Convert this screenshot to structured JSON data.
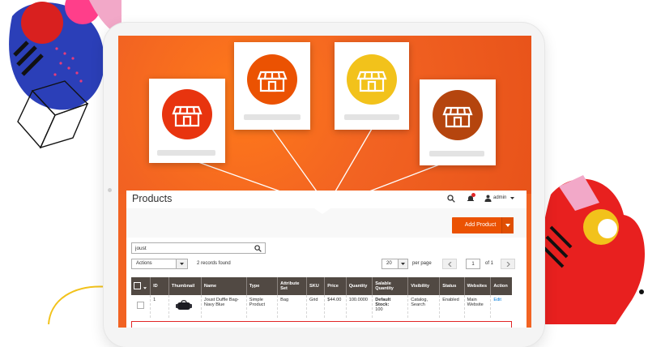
{
  "toolbar": {
    "title": "Products",
    "admin_label": "admin",
    "notification_count": "1",
    "add_product_label": "Add Product"
  },
  "search": {
    "value": "joust"
  },
  "actions": {
    "select_label": "Actions",
    "records_found": "2 records found"
  },
  "pagination": {
    "per_page_value": "20",
    "per_page_label": "per page",
    "current_page": "1",
    "of_label": "of 1"
  },
  "grid": {
    "columns": [
      "ID",
      "Thumbnail",
      "Name",
      "Type",
      "Attribute Set",
      "SKU",
      "Price",
      "Quantity",
      "Salable Quantity",
      "Visibility",
      "Status",
      "Websites",
      "Action"
    ],
    "rows": [
      {
        "id": "1",
        "name": "Joust Duffle Bag-Navy Blue",
        "type": "Simple Product",
        "attribute_set": "Bag",
        "sku": "Grid",
        "price": "$44.00",
        "quantity": "100.0000",
        "salable_label": "Default Stock:",
        "salable_value": "100",
        "visibility": "Catalog, Search",
        "status": "Enabled",
        "websites": "Main Website",
        "action": "Edit"
      }
    ]
  },
  "colors": {
    "accent": "#eb5202",
    "header_bg": "#514943",
    "hero_orange": "#f26322",
    "store_red": "#e8340f",
    "store_orange": "#eb5202",
    "store_yellow": "#f2c21b",
    "store_brown": "#b5450e"
  },
  "icons": [
    "store-icon",
    "search-icon",
    "bell-icon",
    "user-icon",
    "chevron-down-icon",
    "chevron-left-icon",
    "chevron-right-icon",
    "bag-icon"
  ]
}
